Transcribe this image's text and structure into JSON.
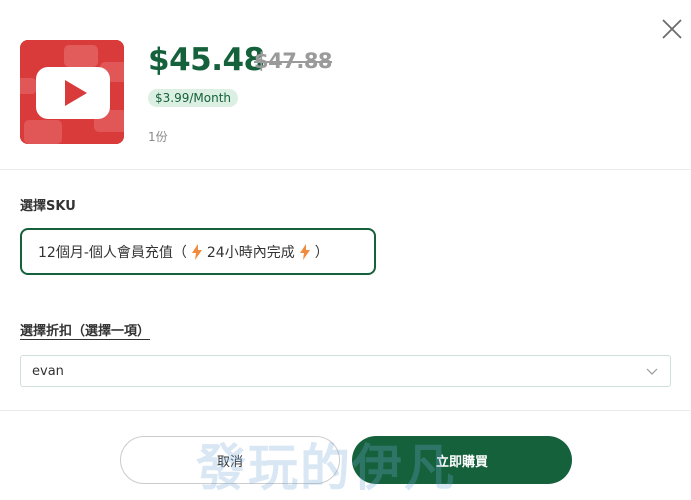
{
  "close": {
    "icon": "close-icon"
  },
  "product": {
    "thumbnail_icon": "youtube-play-icon",
    "price": "$45.48",
    "original_price": "$47.88",
    "monthly": "$3.99/Month",
    "quantity": "1份"
  },
  "sku": {
    "label": "選擇SKU",
    "option": {
      "text_main": "12個月-個人會員充值",
      "paren_open": "（",
      "middle": "24小時內完成",
      "paren_close": "）",
      "bolt_icon": "lightning-icon",
      "bolt_color": "#f08a3c"
    }
  },
  "discount": {
    "label": "選擇折扣（選擇一項）",
    "selected": "evan",
    "chevron_icon": "chevron-down-icon"
  },
  "actions": {
    "cancel": "取消",
    "buy": "立即購買"
  },
  "watermark": "發玩的伊凡",
  "colors": {
    "brand_green": "#14613b",
    "badge_bg": "#dcefe3",
    "thumb_red": "#d93a3a"
  }
}
